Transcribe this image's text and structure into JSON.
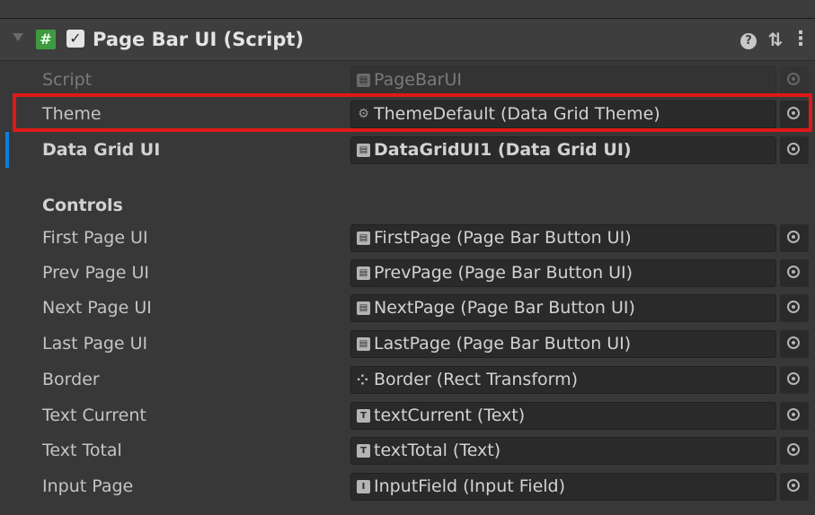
{
  "component": {
    "title": "Page Bar UI (Script)",
    "script_icon": "#",
    "enabled_check": "✓",
    "icons": [
      "foldout-arrow-icon",
      "script-icon",
      "help-icon",
      "preset-icon",
      "context-menu-icon"
    ]
  },
  "rows": [
    {
      "label": "Script",
      "value": "PageBarUI",
      "icon": "script-file-icon",
      "state": "disabled"
    },
    {
      "label": "Theme",
      "value": "ThemeDefault (Data Grid Theme)",
      "icon": "scriptable-object-icon",
      "state": "highlighted"
    },
    {
      "label": "Data Grid UI",
      "value": "DataGridUI1 (Data Grid UI)",
      "icon": "script-file-icon",
      "state": "modified"
    }
  ],
  "controls": {
    "header": "Controls",
    "rows": [
      {
        "label": "First Page UI",
        "value": "FirstPage (Page Bar Button UI)",
        "icon": "script-file-icon"
      },
      {
        "label": "Prev Page UI",
        "value": "PrevPage (Page Bar Button UI)",
        "icon": "script-file-icon"
      },
      {
        "label": "Next Page UI",
        "value": "NextPage (Page Bar Button UI)",
        "icon": "script-file-icon"
      },
      {
        "label": "Last Page UI",
        "value": "LastPage (Page Bar Button UI)",
        "icon": "script-file-icon"
      },
      {
        "label": "Border",
        "value": "Border (Rect Transform)",
        "icon": "rect-transform-icon"
      },
      {
        "label": "Text Current",
        "value": "textCurrent (Text)",
        "icon": "text-component-icon"
      },
      {
        "label": "Text Total",
        "value": "textTotal (Text)",
        "icon": "text-component-icon"
      },
      {
        "label": "Input Page",
        "value": "InputField (Input Field)",
        "icon": "input-field-icon"
      }
    ]
  },
  "colors": {
    "background": "#383838",
    "field": "#2a2a2a",
    "highlight_border": "#e01818",
    "modified_bar": "#0f7fd6",
    "script_icon": "#3e9a3e"
  }
}
